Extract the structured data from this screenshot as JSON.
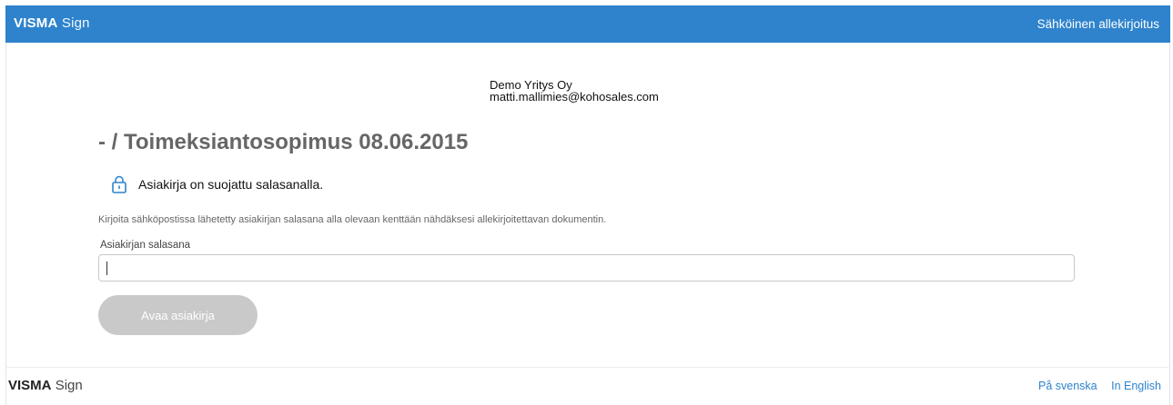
{
  "header": {
    "brand_bold": "VISMA",
    "brand_light": "Sign",
    "service_title": "Sähköinen allekirjoitus"
  },
  "sender": {
    "company": "Demo Yritys Oy",
    "email": "matti.mallimies@kohosales.com"
  },
  "document": {
    "title": "- / Toimeksiantosopimus 08.06.2015",
    "protected_notice": "Asiakirja on suojattu salasanalla.",
    "lock_icon": "lock-icon"
  },
  "form": {
    "instructions": "Kirjoita sähköpostissa lähetetty asiakirjan salasana alla olevaan kenttään nähdäksesi allekirjoitettavan dokumentin.",
    "password_label": "Asiakirjan salasana",
    "password_value": "",
    "open_button": "Avaa asiakirja"
  },
  "footer": {
    "brand_bold": "VISMA",
    "brand_light": "Sign",
    "lang_swedish": "På svenska",
    "lang_english": "In English"
  },
  "colors": {
    "header_blue": "#2e83cc",
    "button_disabled": "#c9c9c9",
    "link": "#2e83cc"
  }
}
